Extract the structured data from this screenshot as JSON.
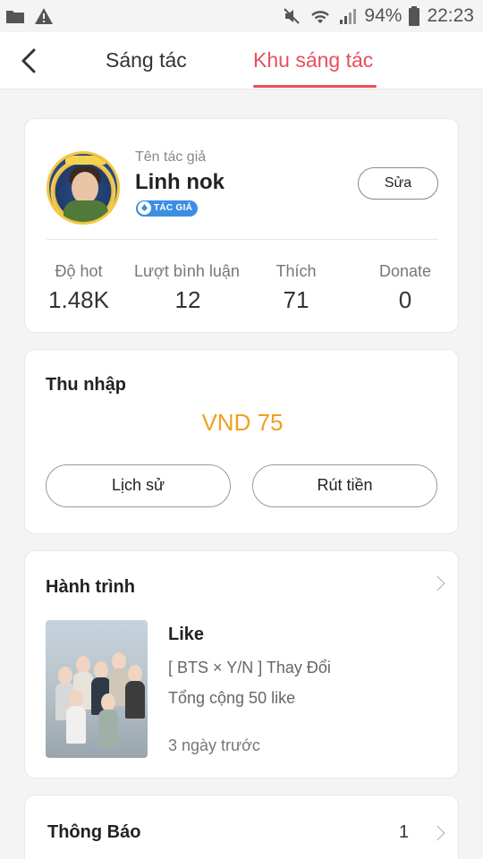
{
  "status_bar": {
    "battery": "94%",
    "time": "22:23"
  },
  "header": {
    "tabs": [
      {
        "label": "Sáng tác",
        "active": false
      },
      {
        "label": "Khu sáng tác",
        "active": true
      }
    ],
    "accent_color": "#e94e5c"
  },
  "profile": {
    "label": "Tên tác giả",
    "name": "Linh nok",
    "badge": "TÁC GIẢ",
    "edit_label": "Sửa",
    "stats": [
      {
        "label": "Độ hot",
        "value": "1.48K"
      },
      {
        "label": "Lượt bình luận x",
        "value": "12"
      },
      {
        "label": "Thích",
        "value": "71"
      },
      {
        "label": "Donate",
        "value": "0"
      }
    ]
  },
  "income": {
    "title": "Thu nhập",
    "amount": "VND 75",
    "amount_color": "#f0a020",
    "buttons": [
      "Lịch sử",
      "Rút tiền"
    ]
  },
  "journey": {
    "title": "Hành trình",
    "entry": {
      "title": "Like",
      "story": "[ BTS × Y/N ] Thay Đổi",
      "summary": "Tổng cộng 50 like",
      "time": "3 ngày trước"
    }
  },
  "notice": {
    "title": "Thông Báo",
    "count": "1"
  }
}
